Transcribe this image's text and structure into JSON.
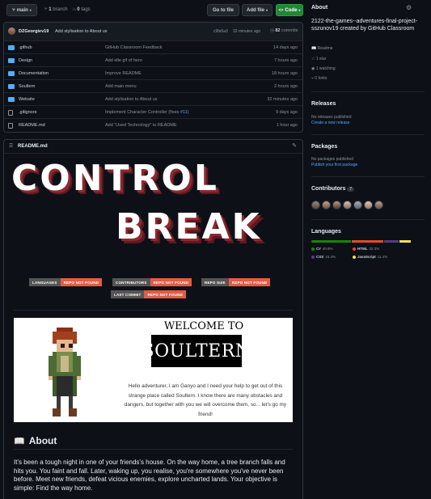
{
  "toolbar": {
    "branch": "main",
    "branches_count": "1",
    "branches_label": "branch",
    "tags_count": "0",
    "tags_label": "tags",
    "goto_file": "Go to file",
    "add_file": "Add file",
    "code": "Code"
  },
  "commit": {
    "author": "DZGeorgiev19",
    "message": "Add stylisation to About us",
    "hash": "c9fa5a3",
    "time": "32 minutes ago",
    "count": "82",
    "count_label": "commits"
  },
  "files": [
    {
      "type": "folder",
      "name": ".github",
      "message": "GitHub Classroom Feedback",
      "time": "14 days ago"
    },
    {
      "type": "folder",
      "name": "Design",
      "message": "Add idle gif of hero",
      "time": "7 hours ago"
    },
    {
      "type": "folder",
      "name": "Documentation",
      "message": "Improve README",
      "time": "18 hours ago"
    },
    {
      "type": "folder",
      "name": "Soultern",
      "message": "Add main menu",
      "time": "2 hours ago"
    },
    {
      "type": "folder",
      "name": "Website",
      "message": "Add stylisation to About us",
      "time": "32 minutes ago"
    },
    {
      "type": "file",
      "name": ".gitignore",
      "message": "Implement Character Controller (fixes ",
      "issue": "#11",
      "message_end": ")",
      "time": "9 days ago"
    },
    {
      "type": "file",
      "name": "README.md",
      "message": "Add \"Used Technology\" to README",
      "time": "1 hour ago"
    }
  ],
  "readme": {
    "header": "README.md",
    "logo_line1": "CONTROL",
    "logo_line2": "BREAK",
    "badges": [
      {
        "label": "LANGUAGES",
        "value": "REPO NOT FOUND"
      },
      {
        "label": "CONTRIBUTORS",
        "value": "REPO NOT FOUND"
      },
      {
        "label": "REPO SIZE",
        "value": "REPO NOT FOUND"
      },
      {
        "label": "LAST COMMIT",
        "value": "REPO NOT FOUND"
      }
    ],
    "welcome_title": "WELCOME TO",
    "game_logo": "SOULTERN",
    "welcome_text": "Hello adventurer, I am Ganyo and I need your help to get out of this strange place called Soultern. I know there are many obstacles and dangers, but together with you we will overcome them, so... let's go my friend!",
    "about_icon": "📖",
    "about_heading": "About",
    "about_text": "It's been a tough night in one of your friends's house. On the way home, a tree branch falls and hits you. You faint and fall. Later, waking up, you realise, you're somewhere you've never been before. Meet new friends, defeat vicious enemies, explore uncharted lands. Your objective is simple: Find the way home."
  },
  "sidebar": {
    "about_heading": "About",
    "description": "2122-the-games--adventures-final-project-sszunov19 created by GitHub Classroom",
    "readme": "Readme",
    "stars": "1 star",
    "watching": "1 watching",
    "forks": "0 forks",
    "releases_heading": "Releases",
    "releases_text": "No releases published",
    "releases_link": "Create a new release",
    "packages_heading": "Packages",
    "packages_text": "No packages published",
    "packages_link": "Publish your first package",
    "contributors_heading": "Contributors",
    "contributors_count": "7",
    "languages_heading": "Languages",
    "languages": [
      {
        "name": "C#",
        "percent": "40.8%",
        "color": "#178600"
      },
      {
        "name": "HTML",
        "percent": "32.3%",
        "color": "#e34c26"
      },
      {
        "name": "CSS",
        "percent": "15.4%",
        "color": "#563d7c"
      },
      {
        "name": "JavaScript",
        "percent": "11.4%",
        "color": "#f1e05a"
      }
    ]
  }
}
